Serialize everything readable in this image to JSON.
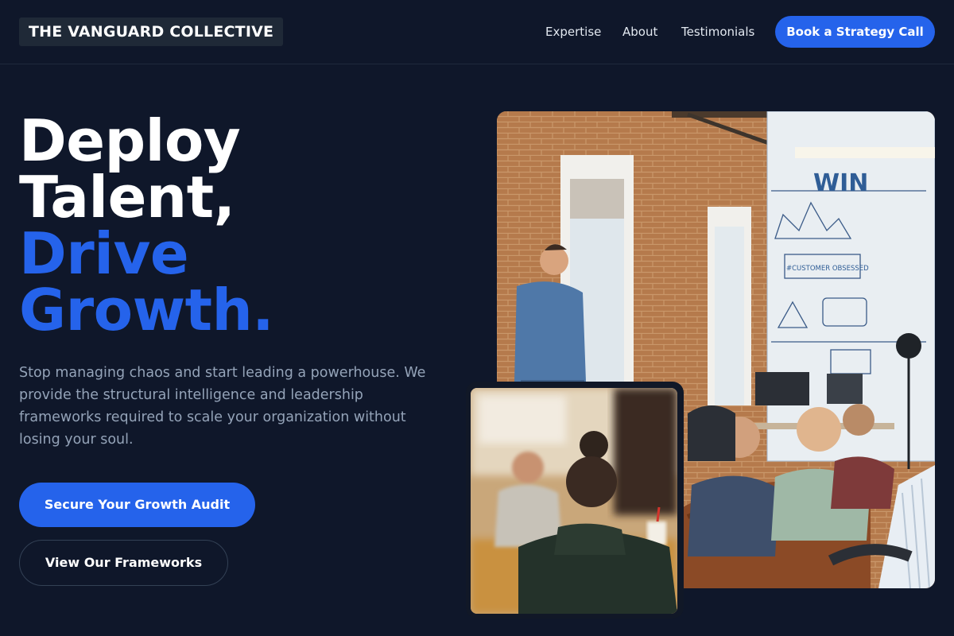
{
  "header": {
    "logo": "THE VANGUARD COLLECTIVE",
    "nav": [
      "Expertise",
      "About",
      "Testimonials"
    ],
    "cta_label": "Book a Strategy Call"
  },
  "hero": {
    "headline_lines": [
      "Deploy",
      "Talent,"
    ],
    "headline_accent_lines": [
      "Drive",
      "Growth."
    ],
    "subtext": "Stop managing chaos and start leading a powerhouse. We provide the structural intelligence and leadership frameworks required to scale your organization without losing your soul.",
    "primary_cta": "Secure Your Growth Audit",
    "secondary_cta": "View Our Frameworks"
  },
  "images": {
    "main": {
      "sign_text": "WIN",
      "banner_text": "#CUSTOMER OBSESSED"
    },
    "small": {}
  },
  "colors": {
    "background": "#0f172a",
    "accent": "#2563eb",
    "muted_text": "#94a3b8"
  }
}
